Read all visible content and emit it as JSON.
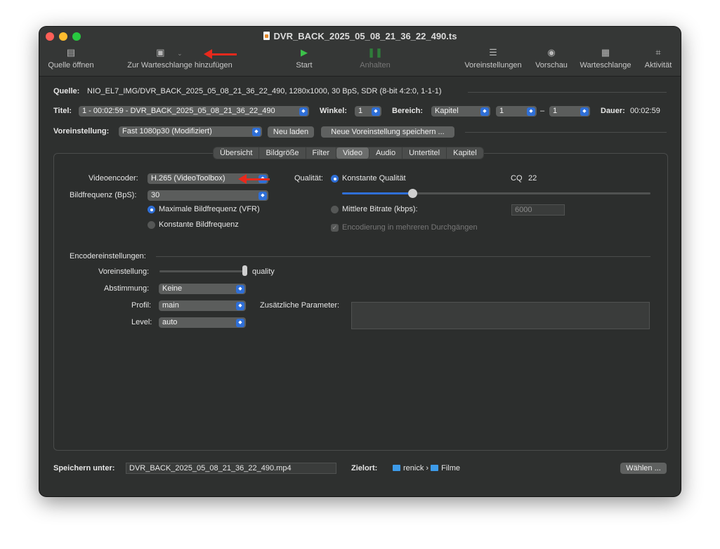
{
  "window": {
    "title": "DVR_BACK_2025_05_08_21_36_22_490.ts"
  },
  "toolbar": {
    "open_source": "Quelle öffnen",
    "add_queue": "Zur Warteschlange hinzufügen",
    "start": "Start",
    "pause": "Anhalten",
    "presets": "Voreinstellungen",
    "preview": "Vorschau",
    "queue": "Warteschlange",
    "activity": "Aktivität"
  },
  "source": {
    "label": "Quelle:",
    "value": "NIO_EL7_IMG/DVR_BACK_2025_05_08_21_36_22_490, 1280x1000, 30 BpS, SDR (8-bit 4:2:0, 1-1-1)"
  },
  "title_row": {
    "title_label": "Titel:",
    "title_value": "1 - 00:02:59 - DVR_BACK_2025_05_08_21_36_22_490",
    "angle_label": "Winkel:",
    "angle_value": "1",
    "range_label": "Bereich:",
    "range_type": "Kapitel",
    "range_from": "1",
    "range_dash": "–",
    "range_to": "1",
    "duration_label": "Dauer:",
    "duration_value": "00:02:59"
  },
  "preset_row": {
    "label": "Voreinstellung:",
    "value": "Fast 1080p30 (Modifiziert)",
    "reload": "Neu laden",
    "save_new": "Neue Voreinstellung speichern ..."
  },
  "tabs": [
    "Übersicht",
    "Bildgröße",
    "Filter",
    "Video",
    "Audio",
    "Untertitel",
    "Kapitel"
  ],
  "active_tab": "Video",
  "video": {
    "encoder_label": "Videoencoder:",
    "encoder_value": "H.265 (VideoToolbox)",
    "framerate_label": "Bildfrequenz (BpS):",
    "framerate_value": "30",
    "vfr_label": "Maximale Bildfrequenz (VFR)",
    "cfr_label": "Konstante Bildfrequenz",
    "quality_label": "Qualität:",
    "constant_quality_label": "Konstante Qualität",
    "cq_label": "CQ",
    "cq_value": "22",
    "quality_slider_fraction": 0.23,
    "avg_bitrate_label": "Mittlere Bitrate (kbps):",
    "avg_bitrate_value": "6000",
    "multipass_label": "Encodierung in mehreren Durchgängen"
  },
  "encoder_settings": {
    "section_label": "Encodereinstellungen:",
    "preset_label": "Voreinstellung:",
    "preset_value_label": "quality",
    "preset_slider_fraction": 1.0,
    "tune_label": "Abstimmung:",
    "tune_value": "Keine",
    "profile_label": "Profil:",
    "profile_value": "main",
    "level_label": "Level:",
    "level_value": "auto",
    "extra_params_label": "Zusätzliche Parameter:",
    "extra_params_value": ""
  },
  "save_row": {
    "label": "Speichern unter:",
    "filename": "DVR_BACK_2025_05_08_21_36_22_490.mp4",
    "dest_label": "Zielort:",
    "path_user": "renick",
    "path_sep": "›",
    "path_folder": "Filme",
    "choose": "Wählen ..."
  },
  "colors": {
    "accent": "#2f6fd7",
    "arrow": "#e8291c",
    "window_bg": "#2e302f"
  }
}
